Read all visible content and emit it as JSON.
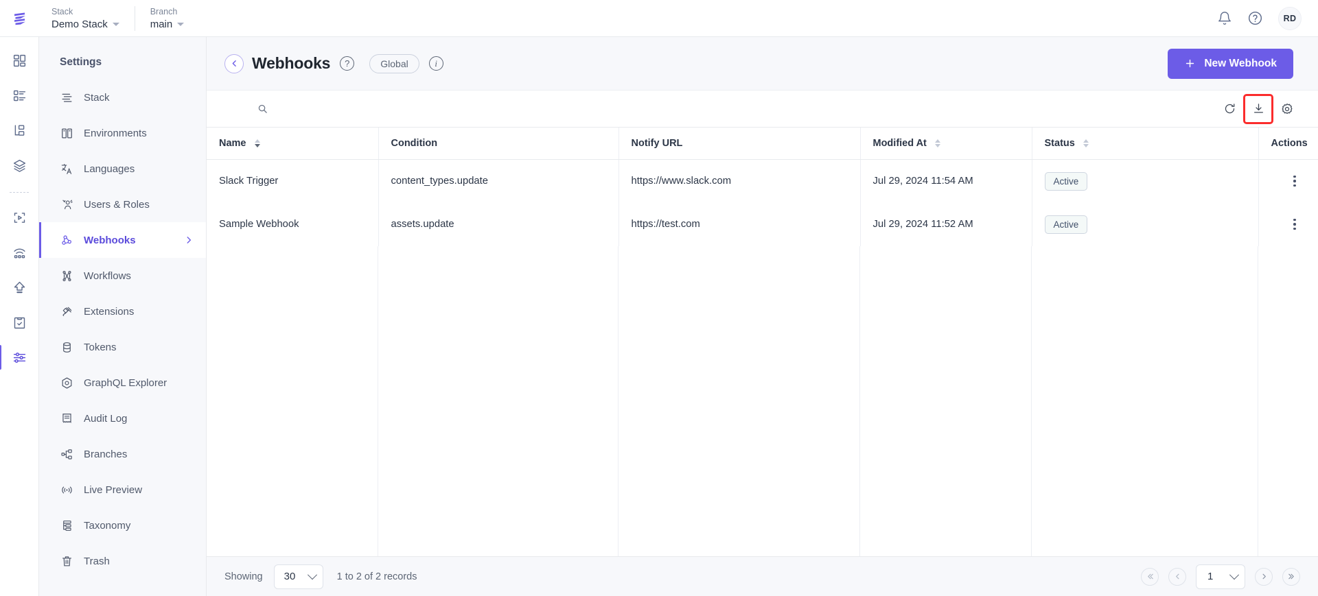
{
  "topbar": {
    "logo_icon": "contentstack-logo-icon",
    "stack": {
      "label": "Stack",
      "value": "Demo Stack"
    },
    "branch": {
      "label": "Branch",
      "value": "main"
    },
    "notifications_icon": "bell-icon",
    "help_icon": "question-circle-icon",
    "avatar_initials": "RD"
  },
  "icon_rail": [
    {
      "name": "dashboard-icon"
    },
    {
      "name": "content-types-icon"
    },
    {
      "name": "entries-icon"
    },
    {
      "name": "assets-stack-icon"
    },
    {
      "name": "live-preview-media-icon"
    },
    {
      "name": "releases-publish-icon"
    },
    {
      "name": "import-upload-icon"
    },
    {
      "name": "tasks-clipboard-icon"
    },
    {
      "name": "settings-sliders-icon"
    }
  ],
  "settings_nav": {
    "title": "Settings",
    "items": [
      {
        "label": "Stack",
        "icon": "stack-icon",
        "active": false
      },
      {
        "label": "Environments",
        "icon": "environments-icon",
        "active": false
      },
      {
        "label": "Languages",
        "icon": "languages-icon",
        "active": false
      },
      {
        "label": "Users & Roles",
        "icon": "users-roles-icon",
        "active": false
      },
      {
        "label": "Webhooks",
        "icon": "webhooks-icon",
        "active": true
      },
      {
        "label": "Workflows",
        "icon": "workflows-icon",
        "active": false
      },
      {
        "label": "Extensions",
        "icon": "extensions-icon",
        "active": false
      },
      {
        "label": "Tokens",
        "icon": "tokens-icon",
        "active": false
      },
      {
        "label": "GraphQL Explorer",
        "icon": "graphql-icon",
        "active": false
      },
      {
        "label": "Audit Log",
        "icon": "audit-log-icon",
        "active": false
      },
      {
        "label": "Branches",
        "icon": "branches-icon",
        "active": false
      },
      {
        "label": "Live Preview",
        "icon": "live-preview-icon",
        "active": false
      },
      {
        "label": "Taxonomy",
        "icon": "taxonomy-icon",
        "active": false
      },
      {
        "label": "Trash",
        "icon": "trash-icon",
        "active": false
      }
    ]
  },
  "page_header": {
    "back_icon": "chevron-left-icon",
    "title": "Webhooks",
    "help_icon": "question-mark-icon",
    "scope_chip": "Global",
    "info_icon": "info-icon",
    "new_button": {
      "label": "New Webhook",
      "icon": "plus-icon"
    },
    "accent_color": "#6c5ce7"
  },
  "toolbar": {
    "search_placeholder": "",
    "search_value": "",
    "search_icon": "search-icon",
    "refresh_icon": "refresh-icon",
    "download_icon": "download-export-icon",
    "settings_icon": "gear-icon",
    "highlight_color": "#fb2c2c"
  },
  "table": {
    "columns": [
      {
        "label": "Name",
        "sortable": true,
        "sort": "desc"
      },
      {
        "label": "Condition",
        "sortable": false
      },
      {
        "label": "Notify URL",
        "sortable": false
      },
      {
        "label": "Modified At",
        "sortable": true,
        "sort": "none"
      },
      {
        "label": "Status",
        "sortable": true,
        "sort": "none"
      },
      {
        "label": "Actions",
        "sortable": false
      }
    ],
    "rows": [
      {
        "name": "Slack Trigger",
        "condition": "content_types.update",
        "notify_url": "https://www.slack.com",
        "modified_at": "Jul 29, 2024 11:54 AM",
        "status": "Active",
        "actions_icon": "kebab-menu-icon"
      },
      {
        "name": "Sample Webhook",
        "condition": "assets.update",
        "notify_url": "https://test.com",
        "modified_at": "Jul 29, 2024 11:52 AM",
        "status": "Active",
        "actions_icon": "kebab-menu-icon"
      }
    ]
  },
  "footer": {
    "showing_label": "Showing",
    "page_size": "30",
    "records_label": "1 to 2 of 2 records",
    "first_icon": "double-chevron-left-icon",
    "prev_icon": "chevron-left-icon",
    "current_page": "1",
    "next_icon": "chevron-right-icon",
    "last_icon": "double-chevron-right-icon"
  }
}
